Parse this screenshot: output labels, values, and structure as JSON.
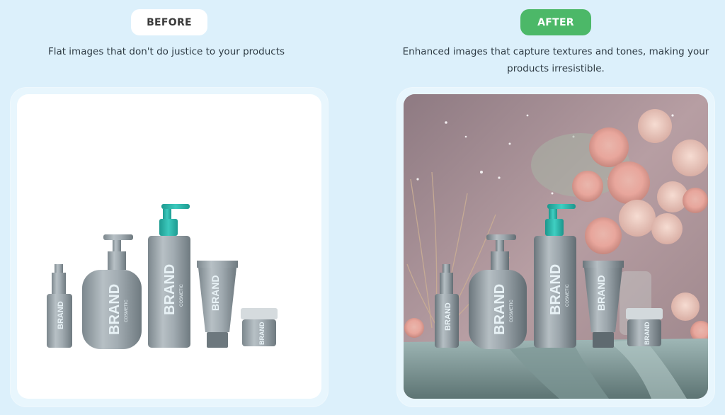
{
  "before": {
    "label": "BEFORE",
    "caption": "Flat images that don't do justice to your products",
    "brand_text": "BRAND",
    "sub_text": "COSMETIC"
  },
  "after": {
    "label": "AFTER",
    "caption_line1": "Enhanced images that capture textures and tones, making your",
    "caption_line2": "products irresistible.",
    "brand_text": "BRAND",
    "sub_text": "COSMETIC"
  },
  "colors": {
    "page_bg": "#dcf0fb",
    "after_pill": "#4cb868",
    "bottle": "#9aa6ad",
    "pump_teal": "#2ab3a8",
    "brand_text": "#e8f2f6"
  }
}
